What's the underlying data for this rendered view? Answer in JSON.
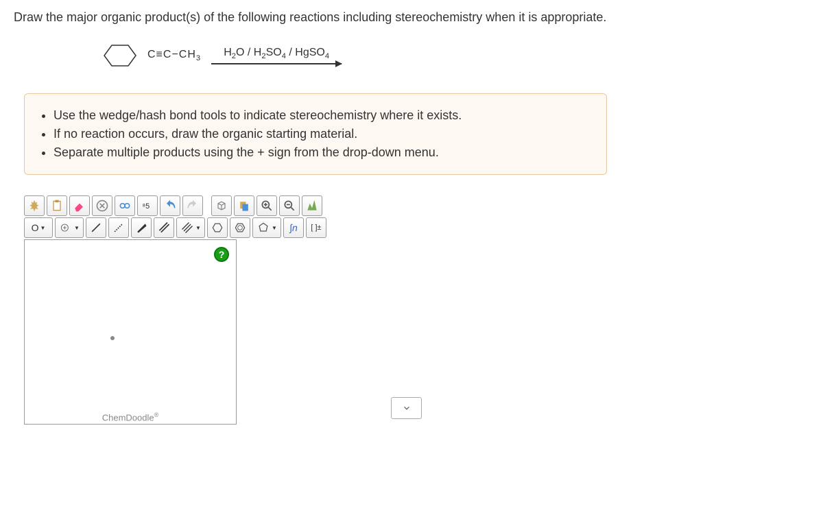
{
  "question": "Draw the major organic product(s) of the following reactions including stereochemistry when it is appropriate.",
  "reaction": {
    "substituent": "C≡C−CH",
    "substituent_sub": "3",
    "reagents_html": "H₂O / H₂SO₄ / HgSO₄"
  },
  "instructions": [
    "Use the wedge/hash bond tools to indicate stereochemistry where it exists.",
    "If no reaction occurs, draw the organic starting material.",
    "Separate multiple products using the + sign from the drop-down menu."
  ],
  "toolbar_row2": {
    "atom": "O",
    "formula": "∫n",
    "charge": "[ ]±"
  },
  "help": "?",
  "brand": "ChemDoodle",
  "brand_sup": "®"
}
